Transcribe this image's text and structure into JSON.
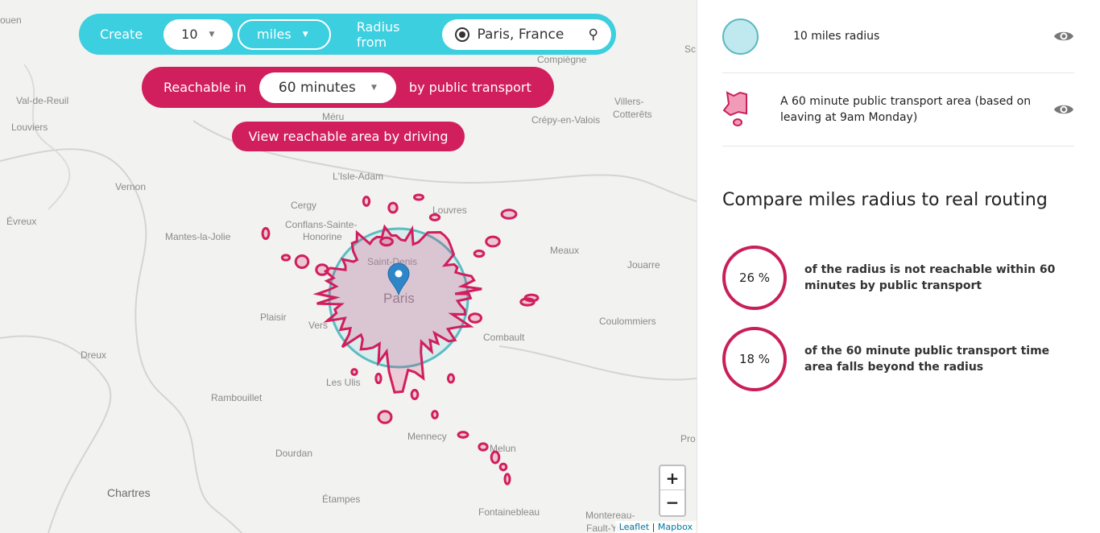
{
  "map": {
    "labels": [
      "ouen",
      "Val-de-Reuil",
      "Louviers",
      "Vernon",
      "Évreux",
      "Mantes-la-Jolie",
      "Cergy",
      "Conflans-Sainte-",
      "Honorine",
      "L'Isle-Adam",
      "Louvres",
      "Méru",
      "Compiègne",
      "Villers-",
      "Cotterêts",
      "Crépy-en-Valois",
      "Meaux",
      "Jouarre",
      "Coulommiers",
      "Plaisir",
      "Dreux",
      "Rambouillet",
      "Les Ulis",
      "Dourdan",
      "Chartres",
      "Étampes",
      "Mennecy",
      "Fontainebleau",
      "Montereau-",
      "Fault-Yonne",
      "Pro",
      "Paris",
      "Saint-Denis",
      "Combault",
      "Sc",
      "Vers",
      "Melun"
    ],
    "zoom_in": "+",
    "zoom_out": "−",
    "attribution": {
      "leaflet": "Leaflet",
      "sep": " | ",
      "mapbox": "Mapbox"
    },
    "colors": {
      "radius": "#3bb3bd",
      "isochrone": "#d11e5d"
    }
  },
  "controls": {
    "create_label": "Create",
    "distance_value": "10",
    "unit_value": "miles",
    "radius_from_label": "Radius from",
    "location_value": "Paris, France",
    "reachable_label": "Reachable in",
    "time_value": "60 minutes",
    "mode_label": "by public transport",
    "driving_button": "View reachable area by driving",
    "colors": {
      "radius_bar": "#3bcfe0",
      "transport_bar": "#d11e5d"
    }
  },
  "panel": {
    "legend": [
      {
        "label": "10 miles radius",
        "icon": "eye-icon"
      },
      {
        "label": "A 60 minute public transport area (based on leaving at 9am Monday)",
        "icon": "eye-icon"
      }
    ],
    "compare_title": "Compare miles radius to real routing",
    "stats": [
      {
        "value": "26 %",
        "text": "of the radius is not reachable within 60 minutes by public transport"
      },
      {
        "value": "18 %",
        "text": "of the 60 minute public transport time area falls beyond the radius"
      }
    ]
  }
}
